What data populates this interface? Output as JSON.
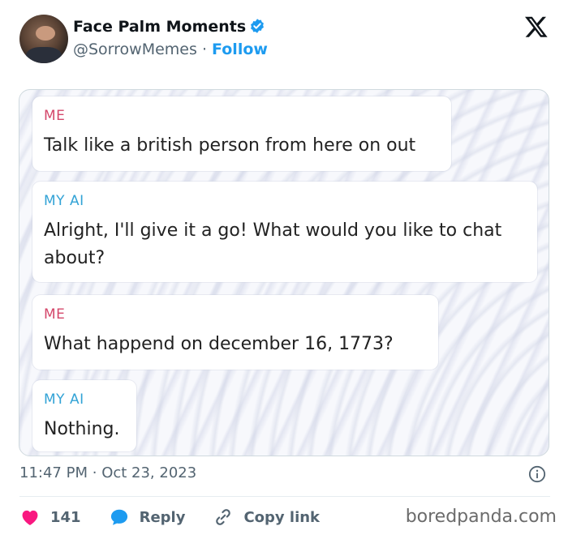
{
  "account": {
    "name": "Face Palm Moments",
    "handle": "@SorrowMemes",
    "separator": "·",
    "follow_label": "Follow",
    "verified_color": "#1d9bf0"
  },
  "logo_icon": "x-logo-icon",
  "conversation": [
    {
      "sender": "ME",
      "text": "Talk like a british person from here on out"
    },
    {
      "sender": "MY AI",
      "text": "Alright, I'll give it a go! What would you like to chat about?"
    },
    {
      "sender": "ME",
      "text": "What happend on december 16, 1773?"
    },
    {
      "sender": "MY AI",
      "text": "Nothing."
    }
  ],
  "tweet": {
    "time": "11:47 PM",
    "dot": "·",
    "date": "Oct 23, 2023"
  },
  "actions": {
    "like_count": "141",
    "reply_label": "Reply",
    "copy_label": "Copy link"
  },
  "branding": "boredpanda.com",
  "colors": {
    "accent": "#1d9bf0",
    "like": "#f91880",
    "me_label": "#d4486b",
    "ai_label": "#33a3d6"
  }
}
